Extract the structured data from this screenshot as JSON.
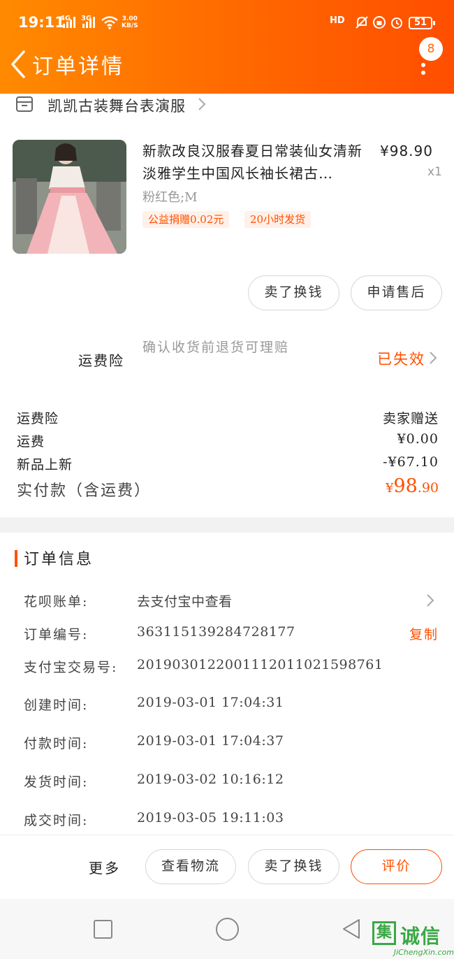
{
  "status_bar": {
    "time": "19:11",
    "net1": "4G",
    "net2": "3G",
    "speed_value": "3.00",
    "speed_unit": "KB/S",
    "hd": "HD",
    "battery": "51"
  },
  "header": {
    "title": "订单详情",
    "badge_count": "8"
  },
  "shop": {
    "name": "凯凯古装舞台表演服"
  },
  "product": {
    "title": "新款改良汉服春夏日常装仙女清新淡雅学生中国风长袖长裙古…",
    "price": "¥98.90",
    "quantity": "x1",
    "sku": "粉红色;M",
    "tags": [
      "公益捐赠0.02元",
      "20小时发货"
    ]
  },
  "item_actions": {
    "sell": "卖了换钱",
    "after_sales": "申请售后"
  },
  "insurance": {
    "label": "运费险",
    "desc": "确认收货前退货可理赔",
    "status": "已失效"
  },
  "fees": [
    {
      "label": "运费险",
      "value": "卖家赠送"
    },
    {
      "label": "运费",
      "value": "¥0.00"
    },
    {
      "label": "新品上新",
      "value": "-¥67.10"
    }
  ],
  "total": {
    "label": "实付款（含运费）",
    "currency": "¥",
    "integer": "98",
    "decimal": ".90"
  },
  "order_info": {
    "title": "订单信息",
    "rows": [
      {
        "key": "花呗账单:",
        "value": "去支付宝中查看"
      },
      {
        "key": "订单编号:",
        "value": "363115139284728177",
        "action": "复制"
      },
      {
        "key": "支付宝交易号:",
        "value": "2019030122001112011021598761"
      },
      {
        "key": "创建时间:",
        "value": "2019-03-01 17:04:31"
      },
      {
        "key": "付款时间:",
        "value": "2019-03-01 17:04:37"
      },
      {
        "key": "发货时间:",
        "value": "2019-03-02 10:16:12"
      },
      {
        "key": "成交时间:",
        "value": "2019-03-05 19:11:03"
      }
    ]
  },
  "bottom_bar": {
    "more": "更多",
    "logistics": "查看物流",
    "sell": "卖了换钱",
    "review": "评价"
  },
  "watermark": {
    "box": "集",
    "text": "诚信",
    "sub": "JiChengXin.com"
  },
  "colors": {
    "accent": "#ff5000",
    "header_start": "#ff8a00",
    "header_end": "#ff4e00"
  }
}
